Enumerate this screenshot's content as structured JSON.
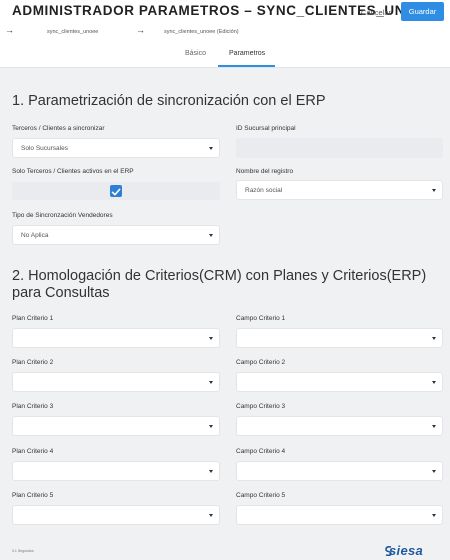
{
  "header": {
    "title": "ADMINISTRADOR PARAMETROS – SYNC_CLIENTES_UNOEE",
    "cancel_label": "Cancelar",
    "save_label": "Guardar"
  },
  "breadcrumbs": [
    "sync_clientes_unoee",
    "sync_clientes_unoee (Edición)"
  ],
  "tabs": [
    {
      "label": "Básico",
      "active": false
    },
    {
      "label": "Parametros",
      "active": true
    }
  ],
  "section1": {
    "title": "1. Parametrización de sincronización con el ERP",
    "terceros_label": "Terceros / Clientes a sincronizar",
    "terceros_value": "Solo Sucursales",
    "id_sucursal_label": "ID Sucursal principal",
    "id_sucursal_value": "",
    "solo_activos_label": "Solo Terceros / Clientes activos en el ERP",
    "solo_activos_checked": true,
    "nombre_registro_label": "Nombre del registro",
    "nombre_registro_value": "Razón social",
    "tipo_sinc_label": "Tipo de Sincronzación Vendedores",
    "tipo_sinc_value": "No Aplica"
  },
  "section2": {
    "title": "2. Homologación de Criterios(CRM) con Planes y Criterios(ERP) para Consultas",
    "rows": [
      {
        "plan_label": "Plan Criterio 1",
        "campo_label": "Campo Criterio 1",
        "plan_value": "",
        "campo_value": ""
      },
      {
        "plan_label": "Plan Criterio 2",
        "campo_label": "Campo Criterio 2",
        "plan_value": "",
        "campo_value": ""
      },
      {
        "plan_label": "Plan Criterio 3",
        "campo_label": "Campo Criterio 3",
        "plan_value": "",
        "campo_value": ""
      },
      {
        "plan_label": "Plan Criterio 4",
        "campo_label": "Campo Criterio 4",
        "plan_value": "",
        "campo_value": ""
      },
      {
        "plan_label": "Plan Criterio 5",
        "campo_label": "Campo Criterio 5",
        "plan_value": "",
        "campo_value": ""
      }
    ]
  },
  "footer": {
    "timing": "0.1 Segundos",
    "logo_text": "siesa"
  },
  "colors": {
    "accent": "#2f8de4",
    "checkbox": "#2f7fd6",
    "logo": "#1f5aa0",
    "background": "#f0f1f3"
  }
}
